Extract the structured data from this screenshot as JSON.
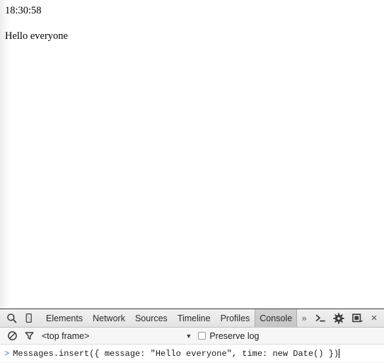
{
  "page": {
    "timestamp": "18:30:58",
    "message": "Hello everyone"
  },
  "devtools": {
    "toolbar": {
      "inspect_icon": "search-icon",
      "device_icon": "device-toggle-icon",
      "tabs": [
        {
          "label": "Elements",
          "selected": false
        },
        {
          "label": "Network",
          "selected": false
        },
        {
          "label": "Sources",
          "selected": false
        },
        {
          "label": "Timeline",
          "selected": false
        },
        {
          "label": "Profiles",
          "selected": false
        },
        {
          "label": "Console",
          "selected": true
        }
      ],
      "overflow_label": "»",
      "drawer_icon": "console-drawer-icon",
      "settings_icon": "gear-icon",
      "dock_icon": "dock-position-icon",
      "close_label": "×"
    },
    "filterbar": {
      "clear_icon": "clear-console-icon",
      "filter_icon": "filter-funnel-icon",
      "context_value": "<top frame>",
      "context_arrow": "▼",
      "preserve_log_label": "Preserve log",
      "preserve_log_checked": false
    },
    "console": {
      "prompt_symbol": ">",
      "input_value": "Messages.insert({ message: \"Hello everyone\", time: new Date() })"
    }
  },
  "colors": {
    "page_background": "#ffffff",
    "devtools_toolbar_top": "#f1f1f1",
    "devtools_toolbar_bottom": "#e3e3e3",
    "selected_tab": "#c6c6c6",
    "border": "#3b3b3b",
    "prompt_arrow": "#4a74c9",
    "text": "#222222"
  }
}
